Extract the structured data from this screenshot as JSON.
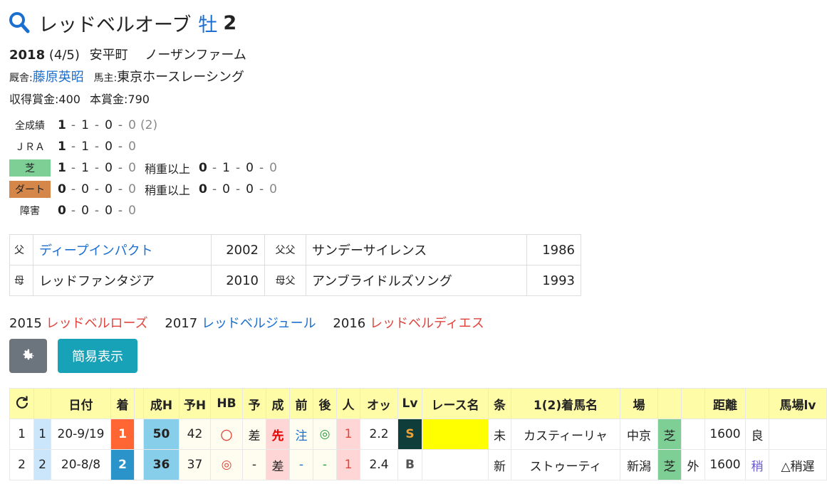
{
  "horse": {
    "name": "レッドベルオーブ",
    "sex": "牡",
    "age": "2"
  },
  "profile": {
    "year": "2018",
    "birthdate": "(4/5)",
    "location": "安平町",
    "breeder": "ノーザンファーム",
    "trainer_label": "厩舎:",
    "trainer": "藤原英昭",
    "owner_label": "馬主:",
    "owner": "東京ホースレーシング",
    "prize": "収得賞金:400",
    "main_prize": "本賞金:790"
  },
  "stats": {
    "all": {
      "label": "全成績",
      "v": [
        "1",
        "1",
        "0",
        "0"
      ],
      "extra": "(2)"
    },
    "jra": {
      "label": "ＪＲＡ",
      "v": [
        "1",
        "1",
        "0",
        "0"
      ]
    },
    "turf": {
      "label": "芝",
      "v": [
        "1",
        "1",
        "0",
        "0"
      ],
      "heavy_label": "稍重以上",
      "heavy": [
        "0",
        "1",
        "0",
        "0"
      ]
    },
    "dirt": {
      "label": "ダート",
      "v": [
        "0",
        "0",
        "0",
        "0"
      ],
      "heavy_label": "稍重以上",
      "heavy": [
        "0",
        "0",
        "0",
        "0"
      ]
    },
    "jump": {
      "label": "障害",
      "v": [
        "0",
        "0",
        "0",
        "0"
      ]
    }
  },
  "pedigree": {
    "sire_label": "父",
    "sire": "ディープインパクト",
    "sire_year": "2002",
    "sire_sire_label": "父父",
    "sire_sire": "サンデーサイレンス",
    "sire_sire_year": "1986",
    "dam_label": "母",
    "dam": "レッドファンタジア",
    "dam_year": "2010",
    "dam_sire_label": "母父",
    "dam_sire": "アンブライドルズソング",
    "dam_sire_year": "1993"
  },
  "siblings": [
    {
      "year": "2015",
      "name": "レッドベルローズ",
      "color": "#e0453d"
    },
    {
      "year": "2017",
      "name": "レッドベルジュール",
      "color": "#1a6fd1"
    },
    {
      "year": "2016",
      "name": "レッドベルディエス",
      "color": "#e0453d"
    }
  ],
  "buttons": {
    "simple": "簡易表示"
  },
  "icons": {
    "title": "search-icon",
    "settings": "gear-icon",
    "refresh": "refresh-icon"
  },
  "table": {
    "headers": [
      "日付",
      "着",
      "成H",
      "予H",
      "HB",
      "予",
      "成",
      "前",
      "後",
      "人",
      "オッ",
      "Lv",
      "レース名",
      "条",
      "1(2)着馬名",
      "場",
      "距離",
      "馬場lv"
    ],
    "rows": [
      {
        "no": "1",
        "idx": "1",
        "date": "20-9/19",
        "pos": "1",
        "seih": "50",
        "yoh": "42",
        "hb": "〇",
        "yo": "差",
        "sei": "先",
        "mae": "注",
        "ato": "◎",
        "pop": "1",
        "odds": "2.2",
        "lv": "S",
        "race": "",
        "cond": "未",
        "winner": "カスティーリャ",
        "place": "中京",
        "surface": "芝",
        "inout": "",
        "dist": "1600",
        "going": "良",
        "baba": ""
      },
      {
        "no": "2",
        "idx": "2",
        "date": "20-8/8",
        "pos": "2",
        "seih": "36",
        "yoh": "37",
        "hb": "◎",
        "yo": "-",
        "sei": "差",
        "mae": "-",
        "ato": "-",
        "pop": "1",
        "odds": "2.4",
        "lv": "B",
        "race": "",
        "cond": "新",
        "winner": "ストゥーティ",
        "place": "新潟",
        "surface": "芝",
        "inout": "外",
        "dist": "1600",
        "going": "稍",
        "baba": "△稍遅"
      }
    ]
  }
}
